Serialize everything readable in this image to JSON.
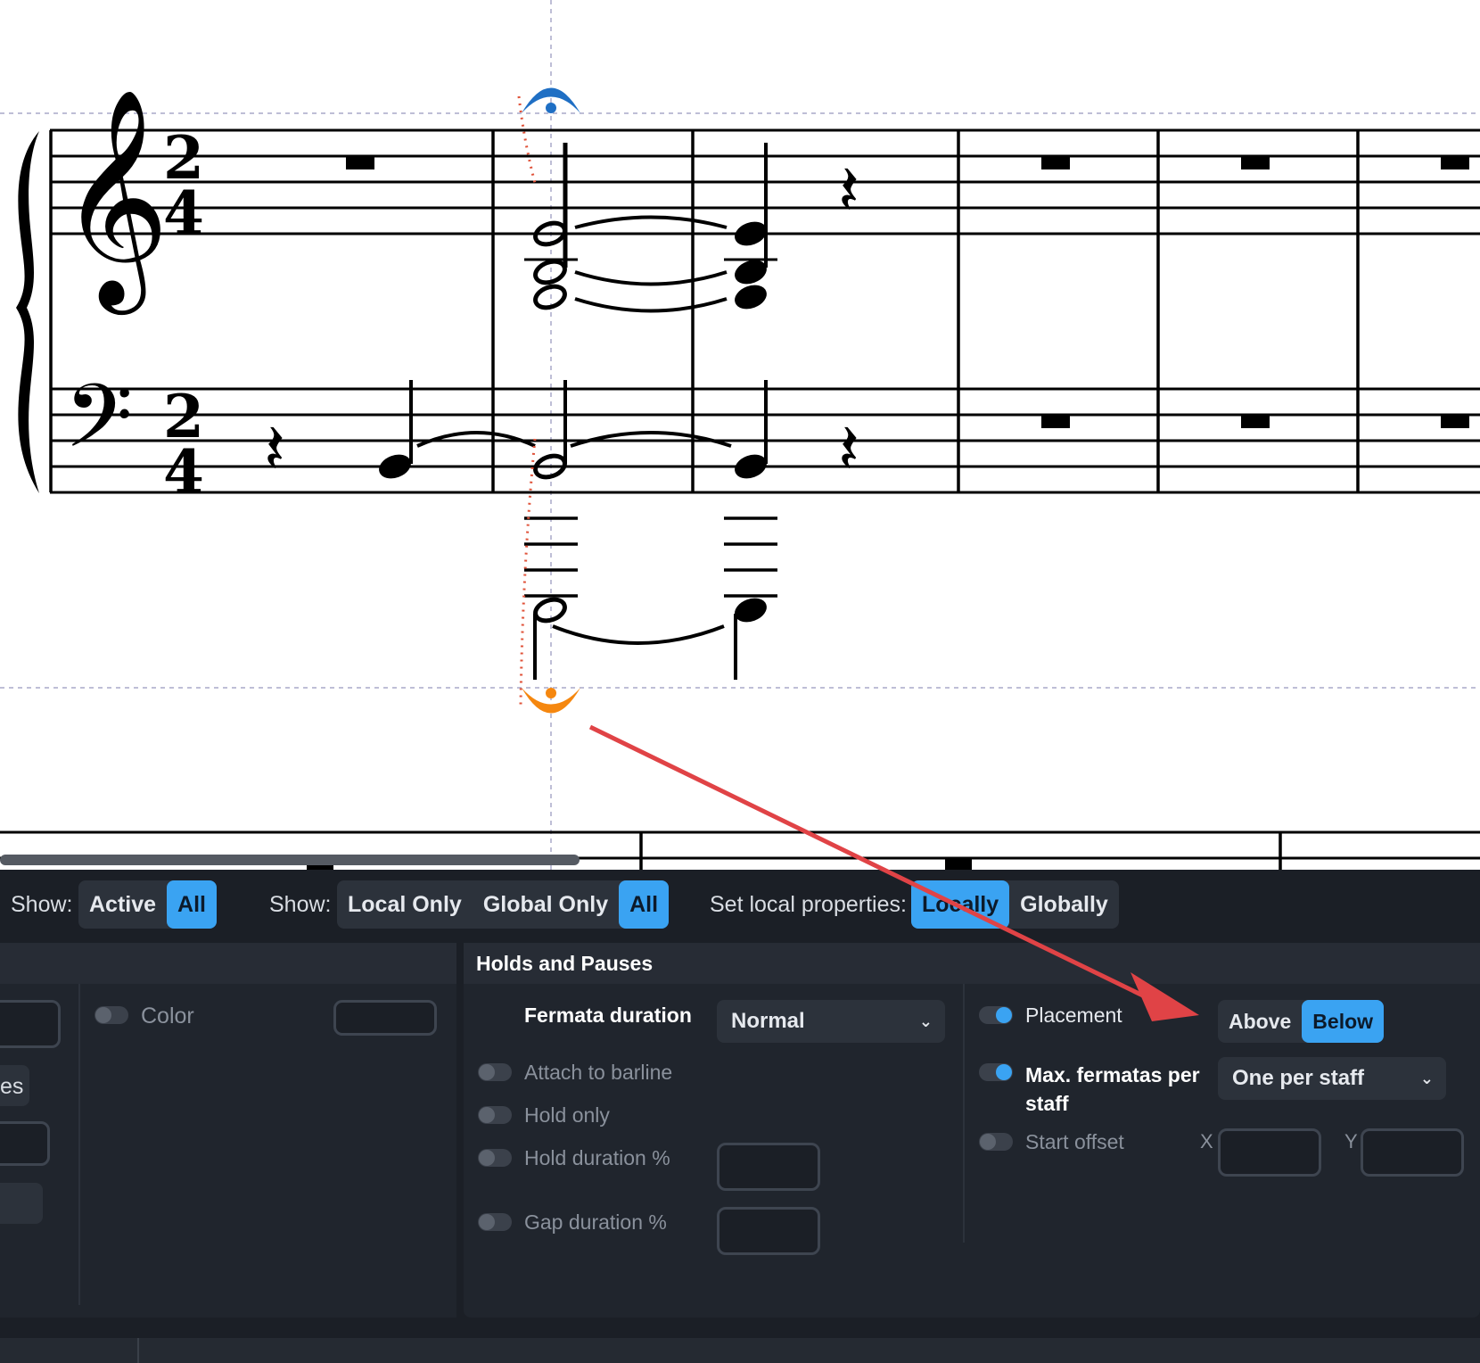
{
  "toolbar": {
    "show_label_1": "Show:",
    "filter_active": "Active",
    "filter_all_1": "All",
    "show_label_2": "Show:",
    "filter_local_only": "Local Only",
    "filter_global_only": "Global Only",
    "filter_all_2": "All",
    "set_local_label": "Set local properties:",
    "locally": "Locally",
    "globally": "Globally"
  },
  "left_panel": {
    "color_label": "Color",
    "partial_label": "es"
  },
  "holds_and_pauses": {
    "title": "Holds and Pauses",
    "fermata_duration_label": "Fermata duration",
    "fermata_duration_value": "Normal",
    "attach_to_barline_label": "Attach to barline",
    "hold_only_label": "Hold only",
    "hold_duration_label": "Hold duration %",
    "gap_duration_label": "Gap duration %",
    "placement_label": "Placement",
    "placement_above": "Above",
    "placement_below": "Below",
    "max_fermatas_label": "Max. fermatas per staff",
    "max_fermatas_value": "One per staff",
    "start_offset_label": "Start offset",
    "x_label": "X",
    "y_label": "Y"
  },
  "colors": {
    "accent": "#3aa3f2",
    "panel_bg": "#1b1f26",
    "fermata_above": "#1f6fc4",
    "fermata_below": "#f5870f",
    "annotation_arrow": "#e04346"
  },
  "icons": {
    "dropdown": "chevron-down-icon"
  }
}
